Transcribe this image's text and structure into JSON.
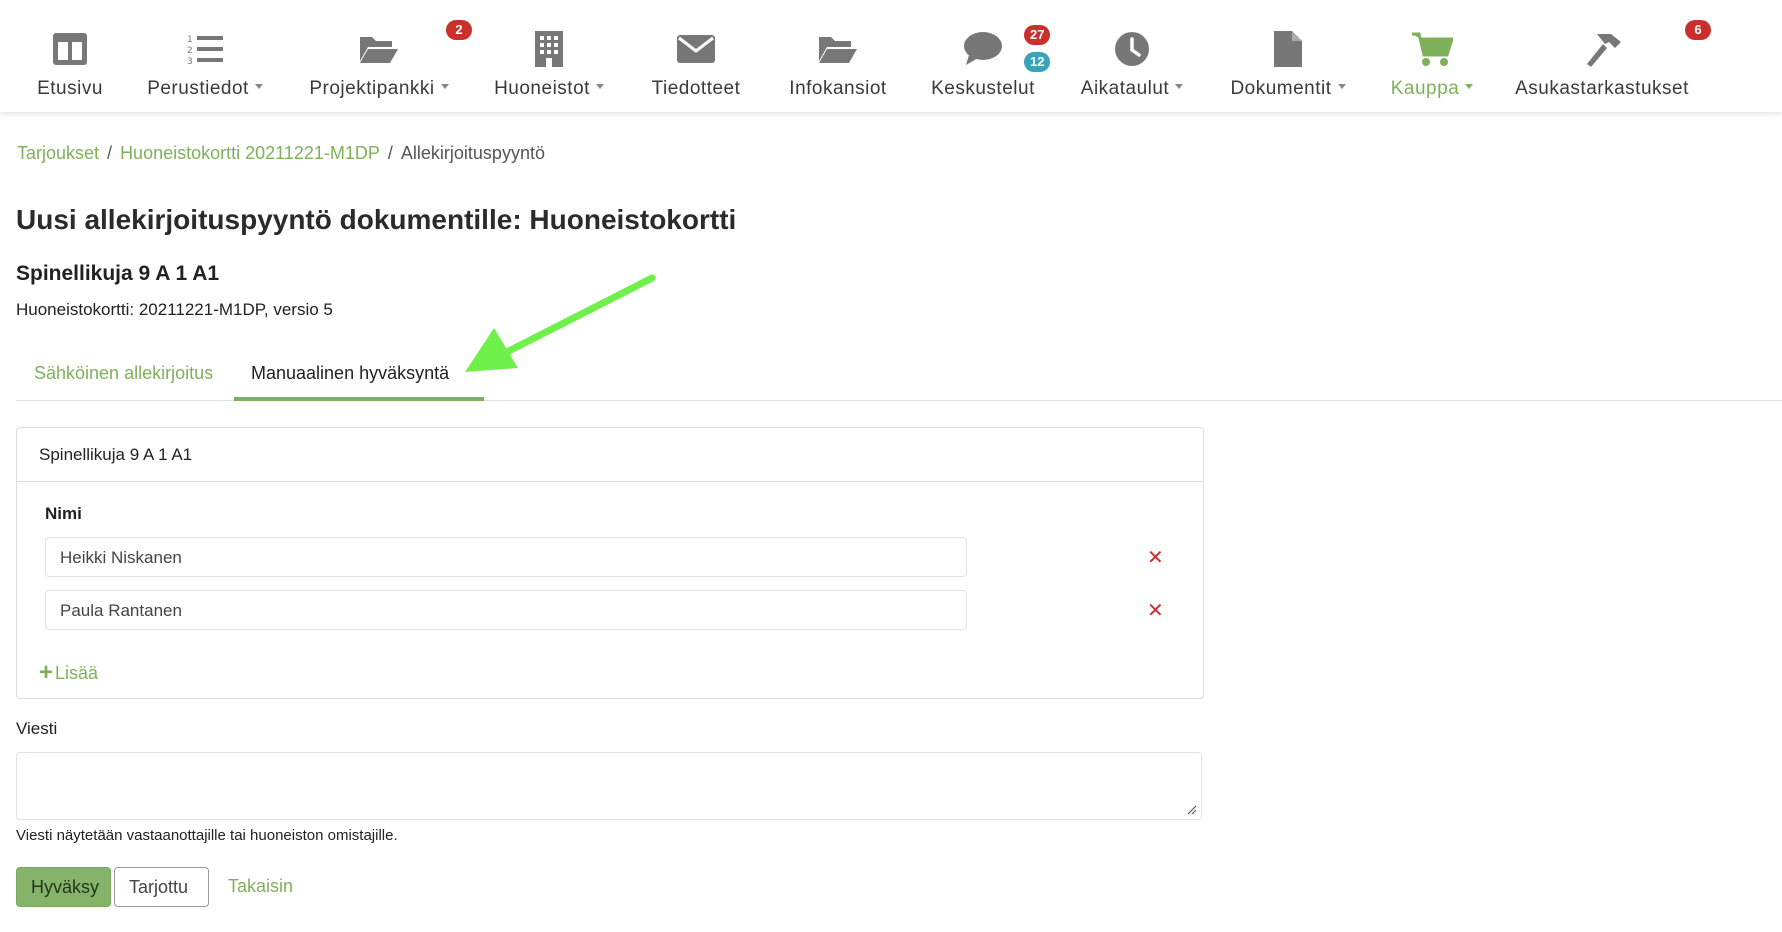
{
  "nav": {
    "items": [
      {
        "label": "Etusivu",
        "icon": "dashboard-icon",
        "caret": false
      },
      {
        "label": "Perustiedot",
        "icon": "numbered-list-icon",
        "caret": true
      },
      {
        "label": "Projektipankki",
        "icon": "folder-open-icon",
        "caret": true,
        "badge": "2"
      },
      {
        "label": "Huoneistot",
        "icon": "building-icon",
        "caret": true
      },
      {
        "label": "Tiedotteet",
        "icon": "envelope-icon",
        "caret": false
      },
      {
        "label": "Infokansiot",
        "icon": "folder-open-icon",
        "caret": false
      },
      {
        "label": "Keskustelut",
        "icon": "chat-bubble-icon",
        "caret": false,
        "badge": "27",
        "badge2": "12"
      },
      {
        "label": "Aikataulut",
        "icon": "clock-icon",
        "caret": true
      },
      {
        "label": "Dokumentit",
        "icon": "document-icon",
        "caret": true
      },
      {
        "label": "Kauppa",
        "icon": "shopping-cart-icon",
        "caret": true,
        "active": true
      },
      {
        "label": "Asukastarkastukset",
        "icon": "hammer-icon",
        "caret": false,
        "badge": "6"
      }
    ]
  },
  "breadcrumb": {
    "items": [
      "Tarjoukset",
      "Huoneistokortti 20211221-M1DP"
    ],
    "current": "Allekirjoituspyyntö"
  },
  "page": {
    "title": "Uusi allekirjoituspyyntö dokumentille: Huoneistokortti",
    "address": "Spinellikuja 9 A 1 A1",
    "subline": "Huoneistokortti: 20211221-M1DP, versio 5"
  },
  "tabs": {
    "electronic": "Sähköinen allekirjoitus",
    "manual": "Manuaalinen hyväksyntä",
    "active": "manual"
  },
  "card": {
    "header": "Spinellikuja 9 A 1 A1",
    "name_label": "Nimi",
    "names": [
      "Heikki Niskanen",
      "Paula Rantanen"
    ],
    "add_label": "Lisää"
  },
  "message": {
    "label": "Viesti",
    "value": "",
    "help": "Viesti näytetään vastaanottajille tai huoneiston omistajille."
  },
  "buttons": {
    "approve": "Hyväksy",
    "offered": "Tarjottu",
    "back": "Takaisin"
  },
  "colors": {
    "accent": "#7fb05a",
    "badge_red": "#c9302c",
    "badge_blue": "#3aa3b9",
    "annotation_arrow": "#6ff04a"
  }
}
